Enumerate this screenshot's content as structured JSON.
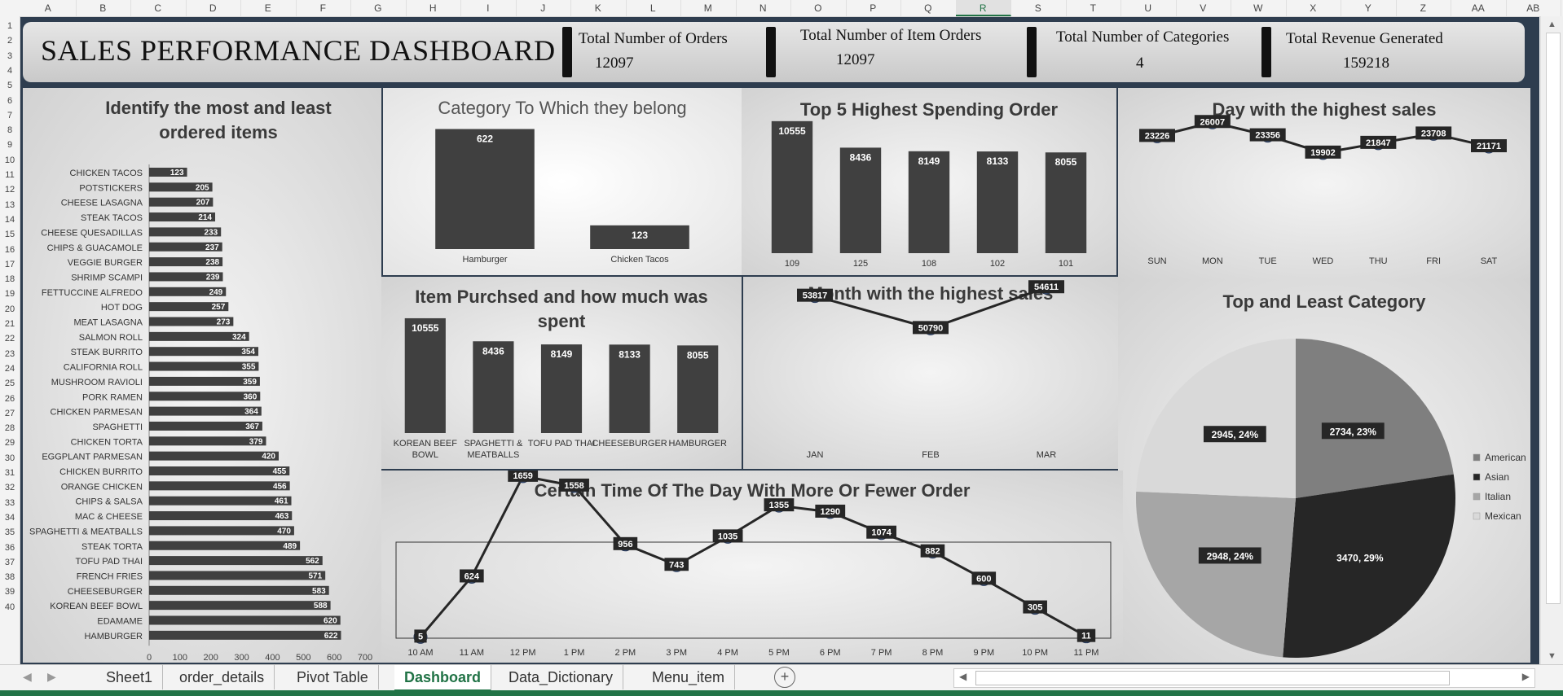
{
  "columns": [
    "A",
    "B",
    "C",
    "D",
    "E",
    "F",
    "G",
    "H",
    "I",
    "J",
    "K",
    "L",
    "M",
    "N",
    "O",
    "P",
    "Q",
    "R",
    "S",
    "T",
    "U",
    "V",
    "W",
    "X",
    "Y",
    "Z",
    "AA",
    "AB"
  ],
  "selected_column": "R",
  "rows": [
    "1",
    "2",
    "3",
    "4",
    "5",
    "6",
    "7",
    "8",
    "9",
    "10",
    "11",
    "12",
    "13",
    "14",
    "15",
    "16",
    "17",
    "18",
    "19",
    "20",
    "21",
    "22",
    "23",
    "24",
    "25",
    "26",
    "27",
    "28",
    "29",
    "30",
    "31",
    "32",
    "33",
    "34",
    "35",
    "36",
    "37",
    "38",
    "39",
    "40"
  ],
  "header": {
    "title": "SALES PERFORMANCE DASHBOARD",
    "kpis": [
      {
        "label": "Total Number of Orders",
        "value": "12097"
      },
      {
        "label": "Total Number of Item Orders",
        "value": "12097"
      },
      {
        "label": "Total Number of Categories",
        "value": "4"
      },
      {
        "label": "Total Revenue Generated",
        "value": "159218"
      }
    ]
  },
  "panels": {
    "items": {
      "title": "Identify the most and least ordered items"
    },
    "category": {
      "title": "Category To Which they belong"
    },
    "top5": {
      "title": "Top 5 Highest Spending Order"
    },
    "day": {
      "title": "Day with the highest sales"
    },
    "purchased": {
      "title": "Item Purchsed and how much was spent"
    },
    "month": {
      "title": "Month with the highest sales"
    },
    "topleast": {
      "title": "Top and Least Category"
    },
    "time": {
      "title": "Certain Time Of The Day With More Or Fewer Order"
    }
  },
  "chart_data": [
    {
      "id": "items",
      "type": "bar",
      "orientation": "horizontal",
      "categories": [
        "CHICKEN TACOS",
        "POTSTICKERS",
        "CHEESE LASAGNA",
        "STEAK TACOS",
        "CHEESE QUESADILLAS",
        "CHIPS & GUACAMOLE",
        "VEGGIE BURGER",
        "SHRIMP SCAMPI",
        "FETTUCCINE ALFREDO",
        "HOT DOG",
        "MEAT LASAGNA",
        "SALMON ROLL",
        "STEAK BURRITO",
        "CALIFORNIA ROLL",
        "MUSHROOM RAVIOLI",
        "PORK RAMEN",
        "CHICKEN PARMESAN",
        "SPAGHETTI",
        "CHICKEN TORTA",
        "EGGPLANT PARMESAN",
        "CHICKEN BURRITO",
        "ORANGE CHICKEN",
        "CHIPS & SALSA",
        "MAC & CHEESE",
        "SPAGHETTI & MEATBALLS",
        "STEAK TORTA",
        "TOFU PAD THAI",
        "FRENCH FRIES",
        "CHEESEBURGER",
        "KOREAN BEEF BOWL",
        "EDAMAME",
        "HAMBURGER"
      ],
      "values": [
        123,
        205,
        207,
        214,
        233,
        237,
        238,
        239,
        249,
        257,
        273,
        324,
        354,
        355,
        359,
        360,
        364,
        367,
        379,
        420,
        455,
        456,
        461,
        463,
        470,
        489,
        562,
        571,
        583,
        588,
        620,
        622
      ],
      "xticks": [
        "0",
        "100",
        "200",
        "300",
        "400",
        "500",
        "600",
        "700"
      ],
      "xlim": [
        0,
        700
      ]
    },
    {
      "id": "category",
      "type": "bar",
      "categories": [
        "Hamburger",
        "Chicken Tacos"
      ],
      "values": [
        622,
        123
      ],
      "ylim": [
        0,
        700
      ]
    },
    {
      "id": "top5",
      "type": "bar",
      "categories": [
        "109",
        "125",
        "108",
        "102",
        "101"
      ],
      "values": [
        10555,
        8436,
        8149,
        8133,
        8055
      ],
      "ylim": [
        0,
        11000
      ]
    },
    {
      "id": "day",
      "type": "line",
      "categories": [
        "SUN",
        "MON",
        "TUE",
        "WED",
        "THU",
        "FRI",
        "SAT"
      ],
      "values": [
        23226,
        26007,
        23356,
        19902,
        21847,
        23708,
        21171
      ]
    },
    {
      "id": "purchased",
      "type": "bar",
      "categories": [
        "KOREAN BEEF BOWL",
        "SPAGHETTI & MEATBALLS",
        "TOFU PAD THAI",
        "CHEESEBURGER",
        "HAMBURGER"
      ],
      "values": [
        10555,
        8436,
        8149,
        8133,
        8055
      ],
      "ylim": [
        0,
        11000
      ]
    },
    {
      "id": "month",
      "type": "line",
      "categories": [
        "JAN",
        "FEB",
        "MAR"
      ],
      "values": [
        53817,
        50790,
        54611
      ]
    },
    {
      "id": "time",
      "type": "line",
      "categories": [
        "10 AM",
        "11 AM",
        "12 PM",
        "1 PM",
        "2 PM",
        "3 PM",
        "4 PM",
        "5 PM",
        "6 PM",
        "7 PM",
        "8 PM",
        "9 PM",
        "10 PM",
        "11 PM"
      ],
      "values": [
        5,
        624,
        1659,
        1558,
        956,
        743,
        1035,
        1355,
        1290,
        1074,
        882,
        600,
        305,
        11
      ]
    },
    {
      "id": "topleast",
      "type": "pie",
      "slices": [
        {
          "name": "American",
          "value": 2734,
          "label": "2734, 23%",
          "color": "#7f7f7f"
        },
        {
          "name": "Asian",
          "value": 3470,
          "label": "3470, 29%",
          "color": "#262626"
        },
        {
          "name": "Italian",
          "value": 2948,
          "label": "2948, 24%",
          "color": "#a6a6a6"
        },
        {
          "name": "Mexican",
          "value": 2945,
          "label": "2945, 24%",
          "color": "#d9d9d9"
        }
      ],
      "legend": "right"
    }
  ],
  "tabs": [
    "Sheet1",
    "order_details",
    "Pivot Table",
    "Dashboard",
    "Data_Dictionary",
    "Menu_item"
  ],
  "active_tab": "Dashboard",
  "colors": {
    "bar": "#404040",
    "line": "#262626",
    "accent": "#217346",
    "background": "#2e3d4f"
  }
}
